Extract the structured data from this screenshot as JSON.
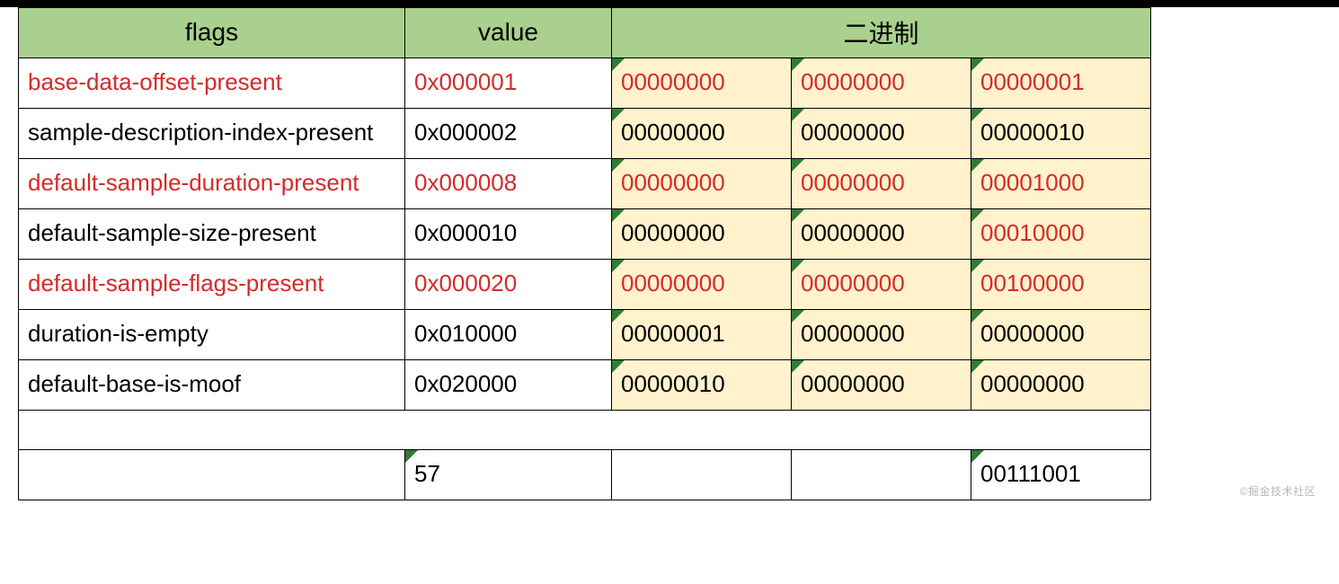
{
  "headers": {
    "flags": "flags",
    "value": "value",
    "binary": "二进制"
  },
  "rows": [
    {
      "flag": "base-data-offset-present",
      "value": "0x000001",
      "bin": [
        "00000000",
        "00000000",
        "00000001"
      ],
      "highlight": true,
      "flag_red": true,
      "value_red": true,
      "bin_red": [
        true,
        true,
        true
      ]
    },
    {
      "flag": "sample-description-index-present",
      "value": "0x000002",
      "bin": [
        "00000000",
        "00000000",
        "00000010"
      ],
      "highlight": true,
      "flag_red": false,
      "value_red": false,
      "bin_red": [
        false,
        false,
        false
      ]
    },
    {
      "flag": "default-sample-duration-present",
      "value": "0x000008",
      "bin": [
        "00000000",
        "00000000",
        "00001000"
      ],
      "highlight": true,
      "flag_red": true,
      "value_red": true,
      "bin_red": [
        true,
        true,
        true
      ]
    },
    {
      "flag": "default-sample-size-present",
      "value": "0x000010",
      "bin": [
        "00000000",
        "00000000",
        "00010000"
      ],
      "highlight": true,
      "flag_red": false,
      "value_red": false,
      "bin_red": [
        false,
        false,
        true
      ]
    },
    {
      "flag": "default-sample-flags-present",
      "value": "0x000020",
      "bin": [
        "00000000",
        "00000000",
        "00100000"
      ],
      "highlight": true,
      "flag_red": true,
      "value_red": true,
      "bin_red": [
        true,
        true,
        true
      ]
    },
    {
      "flag": "duration-is-empty",
      "value": "0x010000",
      "bin": [
        "00000001",
        "00000000",
        "00000000"
      ],
      "highlight": true,
      "flag_red": false,
      "value_red": false,
      "bin_red": [
        false,
        false,
        false
      ]
    },
    {
      "flag": "default-base-is-moof",
      "value": "0x020000",
      "bin": [
        "00000010",
        "00000000",
        "00000000"
      ],
      "highlight": true,
      "flag_red": false,
      "value_red": false,
      "bin_red": [
        false,
        false,
        false
      ]
    }
  ],
  "summary": {
    "value": "57",
    "bin3": "00111001"
  },
  "watermark": "©掘金技术社区"
}
